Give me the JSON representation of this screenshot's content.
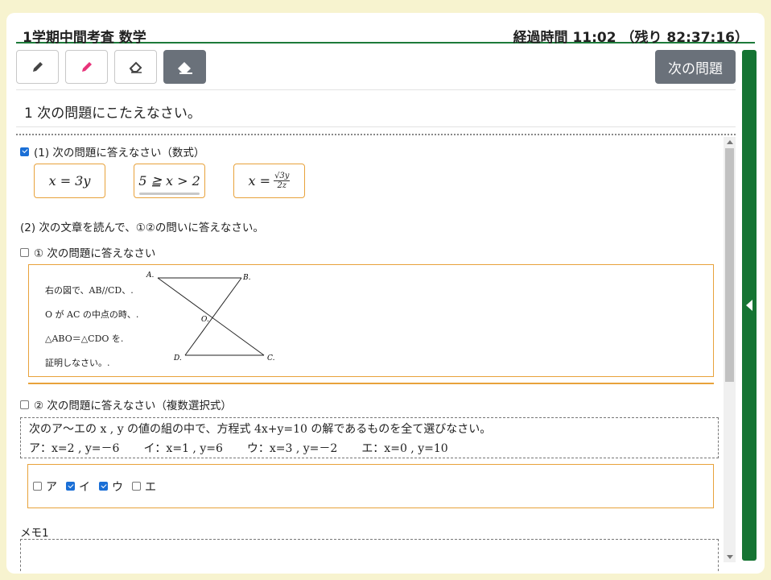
{
  "header": {
    "title": "1学期中間考査 数学",
    "elapsed": "経過時間 11:02 （残り 82:37:16）"
  },
  "toolbar": {
    "tools": [
      "pencil-icon",
      "pen-icon",
      "eraser-icon",
      "eraser-all-icon"
    ],
    "next_label": "次の問題"
  },
  "question": {
    "title": "1 次の問題にこたえなさい。",
    "part1": {
      "label": "(1) 次の問題に答えなさい（数式）",
      "checked": true,
      "answers": [
        "x = 3y",
        "5 ≧ x > 2",
        "x =",
        "√3y",
        "2z"
      ]
    },
    "part2": {
      "label": "(2) 次の文章を読んで、①②の問いに答えなさい。",
      "sub1": {
        "label": "① 次の問題に答えなさい",
        "checked": false,
        "figure_lines": [
          "右の図で、AB//CD、.",
          "O が AC の中点の時、.",
          "△ABO＝△CDO を.",
          "証明しなさい。."
        ],
        "figure_points": [
          "A.",
          "B.",
          "O.",
          "D.",
          "C."
        ]
      },
      "sub2": {
        "label": "② 次の問題に答えなさい（複数選択式）",
        "checked": false,
        "prompt": "次のア～エの x , y の値の組の中で、方程式 4x+y=10 の解であるものを全て選びなさい。",
        "options_text": [
          "ア：x=2 , y=－6",
          "イ：x=1 , y=6",
          "ウ：x=3 , y=－2",
          "エ：x=0 , y=10"
        ],
        "choices": [
          {
            "label": "ア",
            "checked": false
          },
          {
            "label": "イ",
            "checked": true
          },
          {
            "label": "ウ",
            "checked": true
          },
          {
            "label": "エ",
            "checked": false
          }
        ]
      }
    },
    "memo_label": "メモ1"
  },
  "colors": {
    "accent_green": "#157433",
    "answer_border": "#e8a23b",
    "button_gray": "#6a717a",
    "pen_pink": "#e8337a",
    "background": "#f7f3cf"
  }
}
